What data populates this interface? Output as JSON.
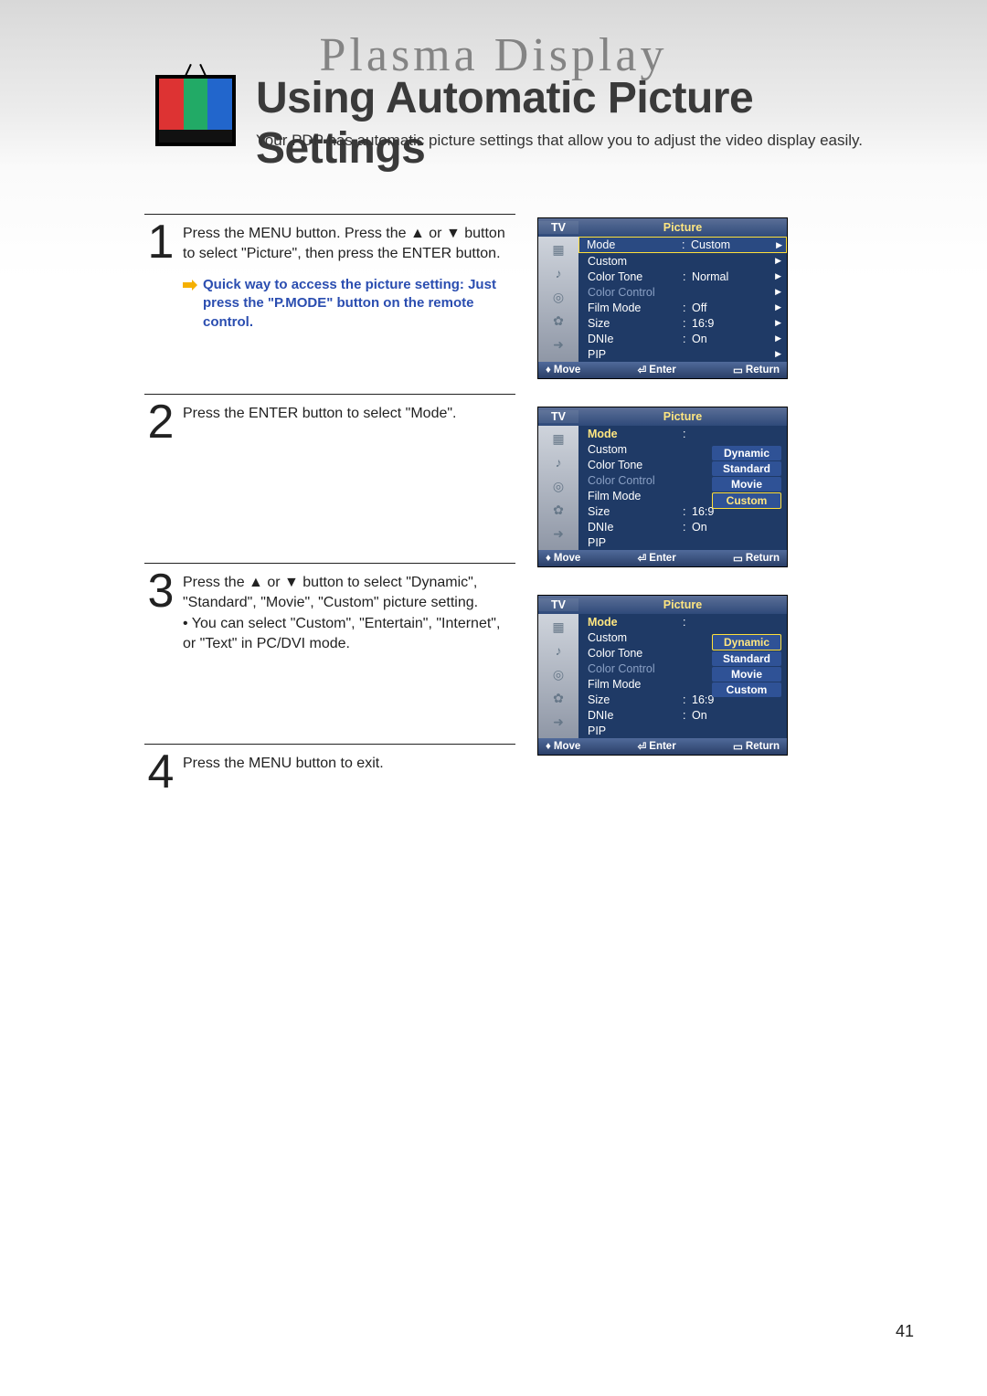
{
  "brand": "Plasma Display",
  "title": "Using Automatic Picture Settings",
  "subtitle": "Your PDP has automatic picture settings that allow you to adjust the video display easily.",
  "page_number": "41",
  "steps": [
    {
      "num": "1",
      "text": "Press the MENU button. Press the ▲ or ▼ button to select \"Picture\", then press the ENTER button.",
      "tip": "Quick way to access the picture setting: Just press the \"P.MODE\" button on the remote control."
    },
    {
      "num": "2",
      "text": "Press the ENTER button to select \"Mode\"."
    },
    {
      "num": "3",
      "text": "Press the ▲ or ▼ button to select \"Dynamic\", \"Standard\", \"Movie\", \"Custom\" picture setting.",
      "bullet": "You can select \"Custom\", \"Entertain\", \"Internet\", or \"Text\" in PC/DVI mode."
    },
    {
      "num": "4",
      "text": "Press the MENU button to exit."
    }
  ],
  "osd_common": {
    "source": "TV",
    "menu_title": "Picture",
    "footer": {
      "move": "Move",
      "enter": "Enter",
      "return": "Return"
    }
  },
  "osd1": {
    "rows": [
      {
        "label": "Mode",
        "value": "Custom",
        "sel": true,
        "arrow": true
      },
      {
        "label": "Custom",
        "value": "",
        "arrow": true
      },
      {
        "label": "Color Tone",
        "value": "Normal",
        "arrow": true
      },
      {
        "label": "Color Control",
        "value": "",
        "dim": true,
        "arrow": true
      },
      {
        "label": "Film Mode",
        "value": "Off",
        "arrow": true
      },
      {
        "label": "Size",
        "value": "16:9",
        "arrow": true
      },
      {
        "label": "DNIe",
        "value": "On",
        "arrow": true
      },
      {
        "label": "PIP",
        "value": "",
        "arrow": true
      }
    ]
  },
  "osd2": {
    "rows": [
      {
        "label": "Mode",
        "value": "",
        "hl": true
      },
      {
        "label": "Custom",
        "value": ""
      },
      {
        "label": "Color Tone",
        "value": ""
      },
      {
        "label": "Color Control",
        "value": "",
        "dim": true
      },
      {
        "label": "Film Mode",
        "value": ""
      },
      {
        "label": "Size",
        "value": "16:9"
      },
      {
        "label": "DNIe",
        "value": "On"
      },
      {
        "label": "PIP",
        "value": ""
      }
    ],
    "options": [
      "Dynamic",
      "Standard",
      "Movie",
      "Custom"
    ],
    "selected_option": "Custom"
  },
  "osd3": {
    "rows": [
      {
        "label": "Mode",
        "value": "",
        "hl": true
      },
      {
        "label": "Custom",
        "value": ""
      },
      {
        "label": "Color Tone",
        "value": ""
      },
      {
        "label": "Color Control",
        "value": "",
        "dim": true
      },
      {
        "label": "Film Mode",
        "value": ""
      },
      {
        "label": "Size",
        "value": "16:9"
      },
      {
        "label": "DNIe",
        "value": "On"
      },
      {
        "label": "PIP",
        "value": ""
      }
    ],
    "options": [
      "Dynamic",
      "Standard",
      "Movie",
      "Custom"
    ],
    "selected_option": "Dynamic"
  }
}
